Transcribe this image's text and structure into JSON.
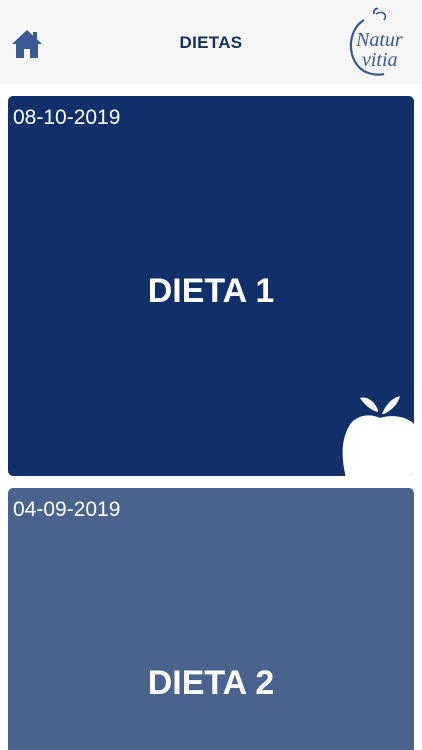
{
  "header": {
    "title": "DIETAS",
    "home_icon": "home-icon",
    "logo": {
      "line1": "Natur",
      "line2": "vitia"
    }
  },
  "diets": [
    {
      "date": "08-10-2019",
      "name": "DIETA 1",
      "color": "#11306a"
    },
    {
      "date": "04-09-2019",
      "name": "DIETA 2",
      "color": "#4a628e"
    }
  ],
  "colors": {
    "brand": "#11306a",
    "header_bg": "#f7f7f7"
  }
}
